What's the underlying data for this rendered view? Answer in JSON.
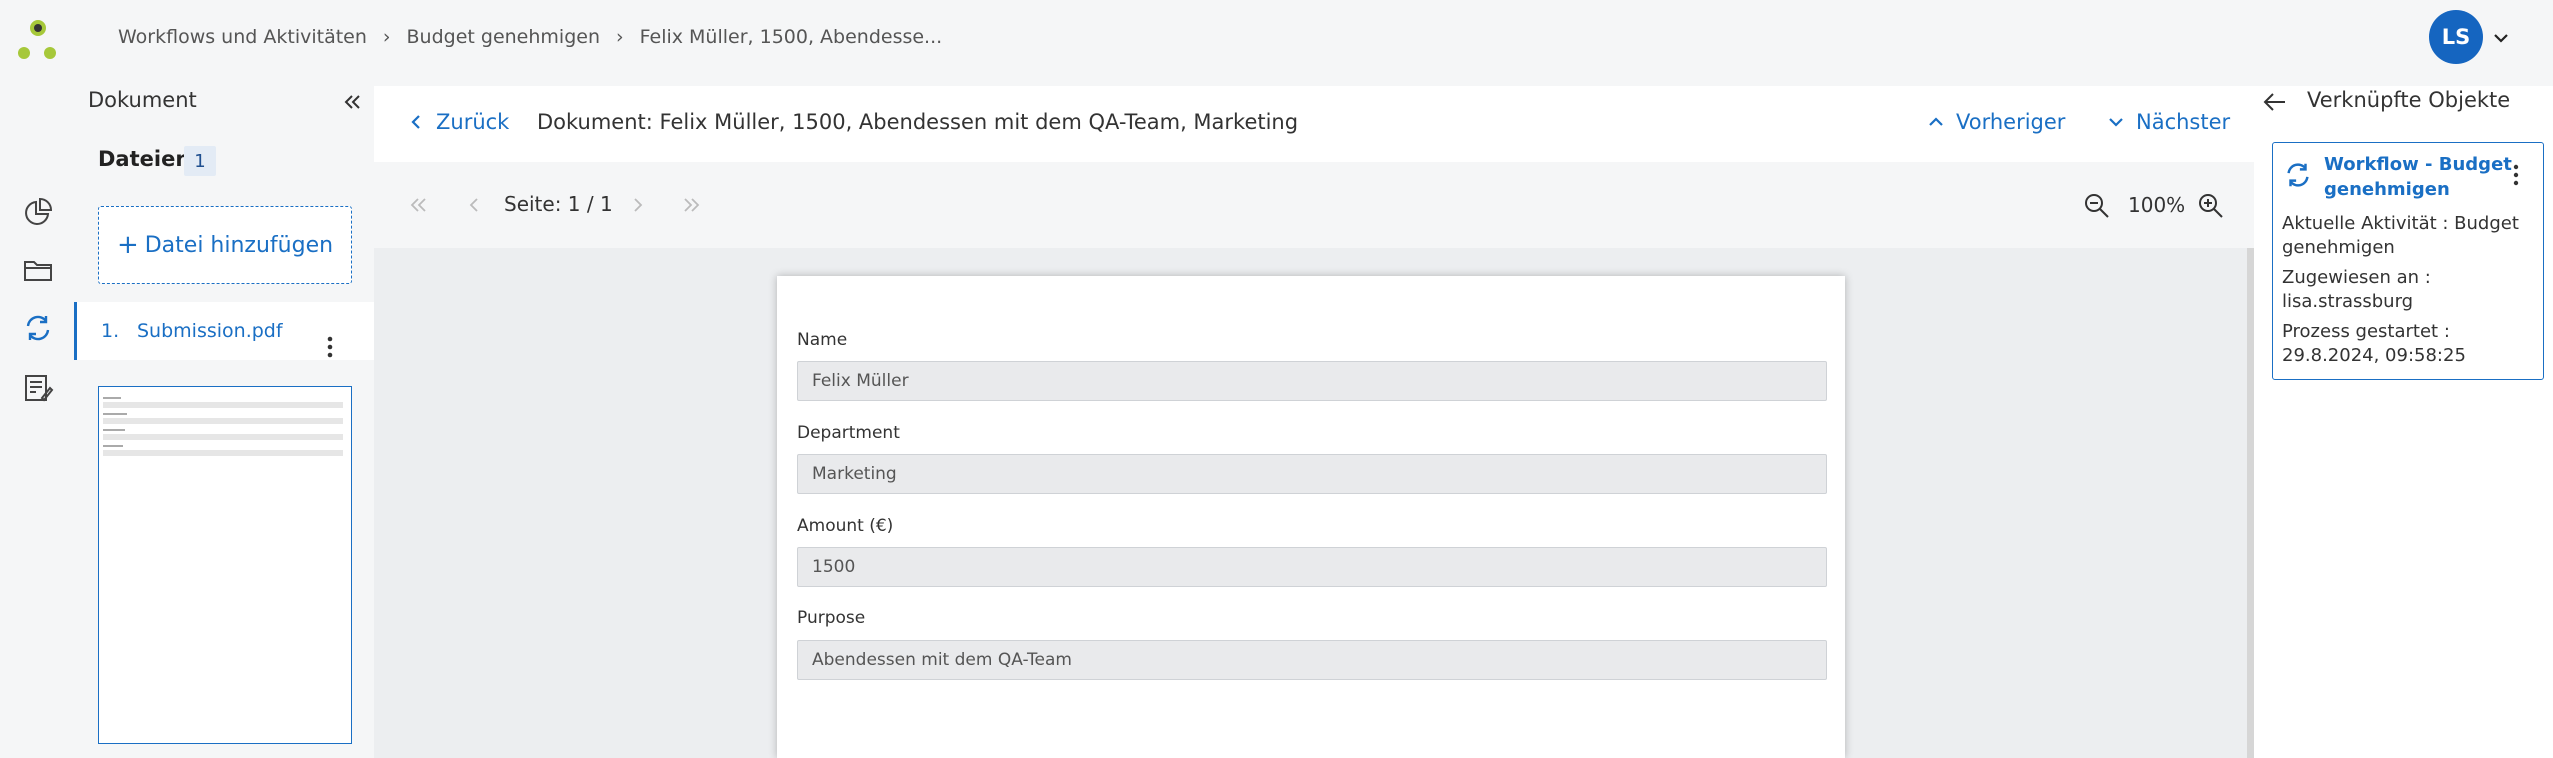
{
  "header": {
    "breadcrumb": [
      "Workflows und Aktivitäten",
      "Budget genehmigen",
      "Felix Müller, 1500, Abendesse..."
    ],
    "avatar_initials": "LS"
  },
  "left_panel": {
    "title": "Dokument",
    "files_label": "Dateien",
    "files_count": "1",
    "add_file_label": "Datei hinzufügen",
    "files": [
      {
        "index": "1.",
        "name": "Submission.pdf"
      }
    ]
  },
  "document": {
    "back_label": "Zurück",
    "title": "Dokument: Felix Müller, 1500, Abendessen mit dem QA-Team, Marketing",
    "prev_label": "Vorheriger",
    "next_label": "Nächster",
    "page_indicator": "Seite: 1 / 1",
    "zoom": "100%",
    "fields": [
      {
        "label": "Name",
        "value": "Felix Müller"
      },
      {
        "label": "Department",
        "value": "Marketing"
      },
      {
        "label": "Amount (€)",
        "value": "1500"
      },
      {
        "label": "Purpose",
        "value": "Abendessen mit dem QA-Team"
      }
    ]
  },
  "right_panel": {
    "title": "Verknüpfte Objekte",
    "card": {
      "title": "Workflow - Budget genehmigen",
      "activity": "Aktuelle Aktivität : Budget genehmigen",
      "assigned": "Zugewiesen an : lisa.strassburg",
      "started": "Prozess gestartet : 29.8.2024, 09:58:25"
    }
  },
  "colors": {
    "accent": "#1a6fc4",
    "logo_green": "#a6c83a",
    "logo_dark": "#333333"
  }
}
